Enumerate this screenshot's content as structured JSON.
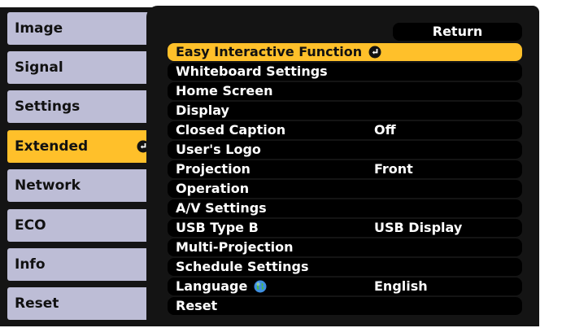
{
  "categories": [
    {
      "label": "Image",
      "active": false
    },
    {
      "label": "Signal",
      "active": false
    },
    {
      "label": "Settings",
      "active": false
    },
    {
      "label": "Extended",
      "active": true
    },
    {
      "label": "Network",
      "active": false
    },
    {
      "label": "ECO",
      "active": false
    },
    {
      "label": "Info",
      "active": false
    },
    {
      "label": "Reset",
      "active": false
    }
  ],
  "return_label": "Return",
  "menu": [
    {
      "label": "Easy Interactive Function",
      "value": "",
      "selected": true,
      "icon": "enter-icon"
    },
    {
      "label": "Whiteboard Settings",
      "value": ""
    },
    {
      "label": "Home Screen",
      "value": ""
    },
    {
      "label": "Display",
      "value": ""
    },
    {
      "label": "Closed Caption",
      "value": "Off"
    },
    {
      "label": "User's Logo",
      "value": ""
    },
    {
      "label": "Projection",
      "value": "Front"
    },
    {
      "label": "Operation",
      "value": ""
    },
    {
      "label": "A/V Settings",
      "value": ""
    },
    {
      "label": "USB Type B",
      "value": "USB Display"
    },
    {
      "label": "Multi-Projection",
      "value": ""
    },
    {
      "label": "Schedule Settings",
      "value": ""
    },
    {
      "label": "Language",
      "value": "English",
      "icon": "globe-icon"
    },
    {
      "label": "Reset",
      "value": ""
    }
  ],
  "colors": {
    "highlight": "#ffc02a",
    "tab_background": "#bdbdd6",
    "panel_background": "#141414",
    "row_background": "#000000"
  }
}
